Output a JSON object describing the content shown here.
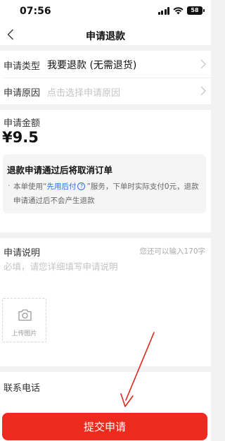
{
  "status_bar": {
    "time": "07:56",
    "battery": "58"
  },
  "nav": {
    "title": "申请退款"
  },
  "form": {
    "type_label": "申请类型",
    "type_value": "我要退款 (无需退货)",
    "reason_label": "申请原因",
    "reason_placeholder": "点击选择申请原因"
  },
  "amount": {
    "label": "申请金额",
    "value": "¥9.5"
  },
  "notice": {
    "title": "退款申请通过后将取消订单",
    "bullet": "·",
    "text_before": "本单使用“",
    "link": "先用后付",
    "help_icon": "?",
    "text_after": "”服务，下单时实际支付0元，退款申请通过后不会产生退款"
  },
  "description": {
    "label": "申请说明",
    "counter": "您还可以输入170字",
    "placeholder": "必填，请您详细填写申请说明",
    "upload_label": "上传图片"
  },
  "contact": {
    "label": "联系电话"
  },
  "submit": {
    "label": "提交申请"
  },
  "colors": {
    "accent": "#ec2a1e",
    "link": "#2b6ee6",
    "annotation_arrow": "#e0251b"
  },
  "icons": [
    "back-chevron-icon",
    "chevron-right-icon",
    "help-icon",
    "camera-icon",
    "signal-icon",
    "wifi-icon",
    "battery-icon",
    "annotation-arrow"
  ]
}
